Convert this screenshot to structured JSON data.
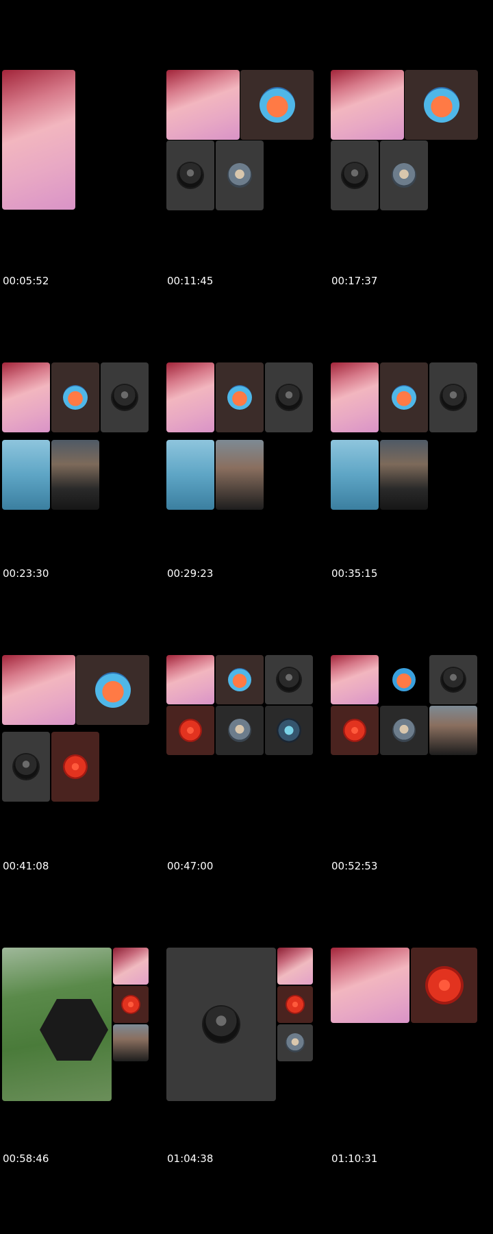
{
  "thumbnails": [
    {
      "timestamp": "00:05:52"
    },
    {
      "timestamp": "00:11:45"
    },
    {
      "timestamp": "00:17:37"
    },
    {
      "timestamp": "00:23:30"
    },
    {
      "timestamp": "00:29:23"
    },
    {
      "timestamp": "00:35:15"
    },
    {
      "timestamp": "00:41:08"
    },
    {
      "timestamp": "00:47:00"
    },
    {
      "timestamp": "00:52:53"
    },
    {
      "timestamp": "00:58:46"
    },
    {
      "timestamp": "01:04:38"
    },
    {
      "timestamp": "01:10:31"
    }
  ]
}
